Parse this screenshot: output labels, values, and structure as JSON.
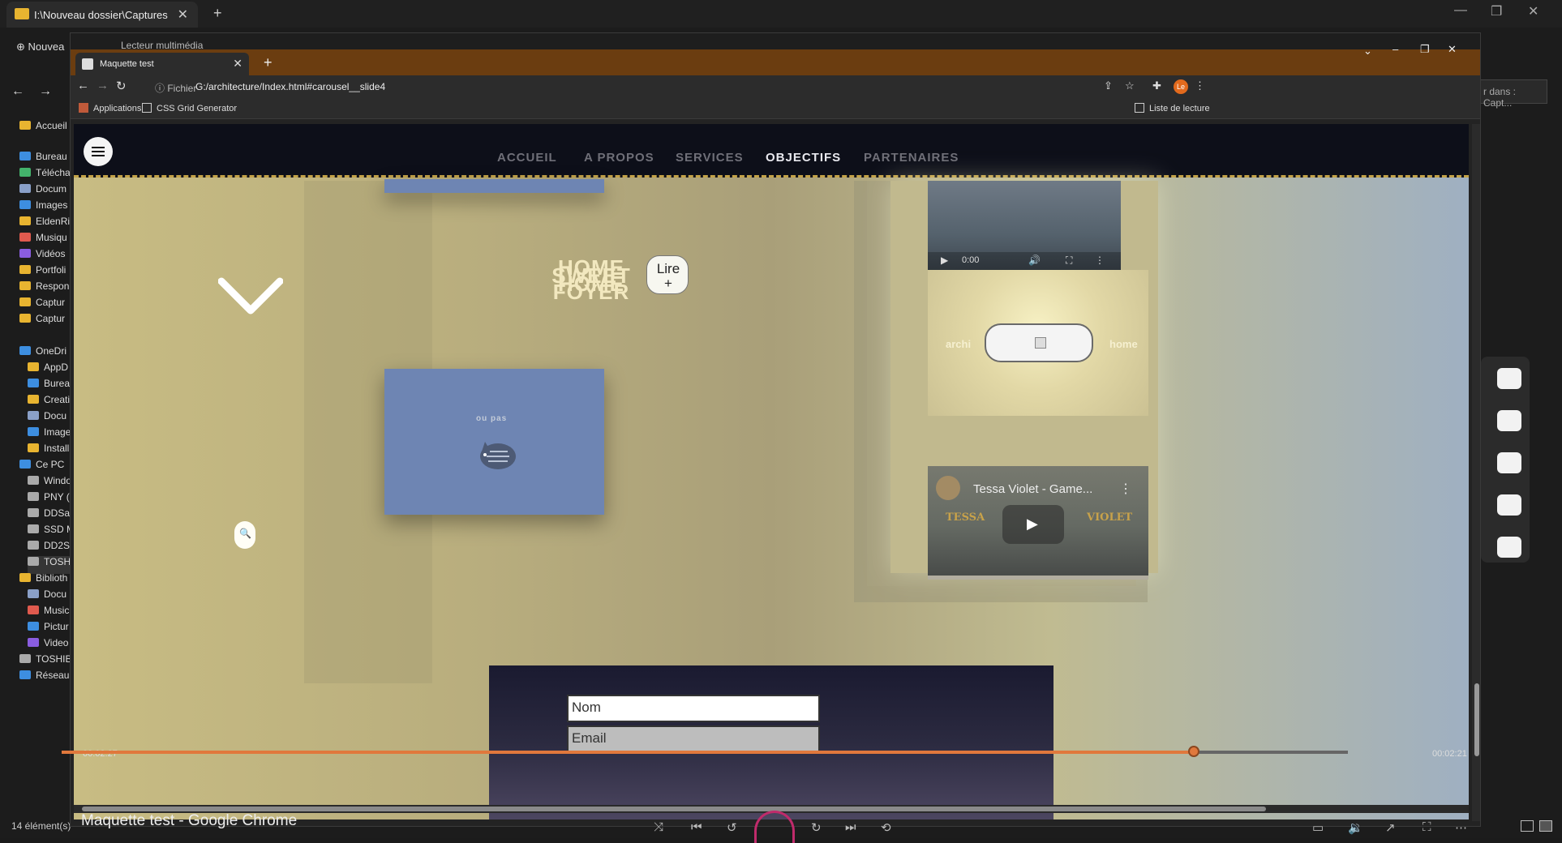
{
  "explorer": {
    "tab_title": "I:\\Nouveau dossier\\Captures",
    "new_label": "Nouvea",
    "search_placeholder": "r dans : Capt...",
    "status": "14 élément(s)",
    "sidebar": [
      {
        "label": "Accueil",
        "icon": "home-icon",
        "color": "#e8b430"
      },
      {
        "label": "Bureau",
        "icon": "desktop-icon",
        "color": "#3d8ee0"
      },
      {
        "label": "Télécha",
        "icon": "download-icon",
        "color": "#43b36b"
      },
      {
        "label": "Docum",
        "icon": "document-icon",
        "color": "#8aa0c8"
      },
      {
        "label": "Images",
        "icon": "image-icon",
        "color": "#3d8ee0"
      },
      {
        "label": "EldenRi",
        "icon": "folder-icon",
        "color": "#e8b430"
      },
      {
        "label": "Musiqu",
        "icon": "music-icon",
        "color": "#e05a4e"
      },
      {
        "label": "Vidéos",
        "icon": "video-icon",
        "color": "#8a5de0"
      },
      {
        "label": "Portfoli",
        "icon": "folder-icon",
        "color": "#e8b430"
      },
      {
        "label": "Respon",
        "icon": "folder-icon",
        "color": "#e8b430"
      },
      {
        "label": "Captur",
        "icon": "folder-icon",
        "color": "#e8b430"
      },
      {
        "label": "Captur",
        "icon": "folder-icon",
        "color": "#e8b430"
      },
      {
        "label": "OneDri",
        "icon": "cloud-icon",
        "color": "#3d8ee0"
      },
      {
        "label": "AppD",
        "icon": "folder-icon",
        "color": "#e8b430"
      },
      {
        "label": "Burea",
        "icon": "desktop-icon",
        "color": "#3d8ee0"
      },
      {
        "label": "Creati",
        "icon": "folder-icon",
        "color": "#e8b430"
      },
      {
        "label": "Docu",
        "icon": "document-icon",
        "color": "#8aa0c8"
      },
      {
        "label": "Image",
        "icon": "image-icon",
        "color": "#3d8ee0"
      },
      {
        "label": "Install",
        "icon": "folder-icon",
        "color": "#e8b430"
      },
      {
        "label": "Ce PC",
        "icon": "computer-icon",
        "color": "#3d8ee0"
      },
      {
        "label": "Windo",
        "icon": "drive-icon",
        "color": "#aaaaaa"
      },
      {
        "label": "PNY (",
        "icon": "drive-icon",
        "color": "#aaaaaa"
      },
      {
        "label": "DDSa",
        "icon": "drive-icon",
        "color": "#aaaaaa"
      },
      {
        "label": "SSD M",
        "icon": "drive-icon",
        "color": "#aaaaaa"
      },
      {
        "label": "DD2S",
        "icon": "drive-icon",
        "color": "#aaaaaa"
      },
      {
        "label": "TOSHI",
        "icon": "drive-icon",
        "color": "#aaaaaa"
      },
      {
        "label": "Biblioth",
        "icon": "folder-icon",
        "color": "#e8b430"
      },
      {
        "label": "Docu",
        "icon": "document-icon",
        "color": "#8aa0c8"
      },
      {
        "label": "Music",
        "icon": "music-icon",
        "color": "#e05a4e"
      },
      {
        "label": "Pictur",
        "icon": "image-icon",
        "color": "#3d8ee0"
      },
      {
        "label": "Video",
        "icon": "video-icon",
        "color": "#8a5de0"
      },
      {
        "label": "TOSHIB",
        "icon": "drive-icon",
        "color": "#aaaaaa"
      },
      {
        "label": "Réseau",
        "icon": "network-icon",
        "color": "#3d8ee0"
      }
    ]
  },
  "media_player": {
    "title": "Lecteur multimédia",
    "elapsed": "00:02:27",
    "remaining": "00:02:21",
    "progress": 0.88,
    "window_label": "Maquette test - Google Chrome"
  },
  "chrome": {
    "tab_title": "Maquette test",
    "url_info": "Fichier",
    "url": "G:/architecture/Index.html#carousel__slide4",
    "bookmarks": [
      "Applications",
      "CSS Grid Generator"
    ],
    "reading_list": "Liste de lecture",
    "avatar": "Le"
  },
  "site": {
    "nav": [
      "ACCUEIL",
      "A PROPOS",
      "SERVICES",
      "OBJECTIFS",
      "PARTENAIRES"
    ],
    "active_nav": "OBJECTIFS",
    "card_text": "ou pas",
    "stack_words": [
      "HOME",
      "SWEET",
      "HOME",
      "FOYER"
    ],
    "lire_line1": "Lire",
    "lire_line2": "+",
    "video_time": "0:00",
    "arch_left": "archi",
    "arch_right": "home",
    "yt_title": "Tessa Violet - Game...",
    "yt_word_left": "TESSA",
    "yt_word_right": "VIOLET",
    "form_name_placeholder": "Nom",
    "form_email_placeholder": "Email"
  }
}
